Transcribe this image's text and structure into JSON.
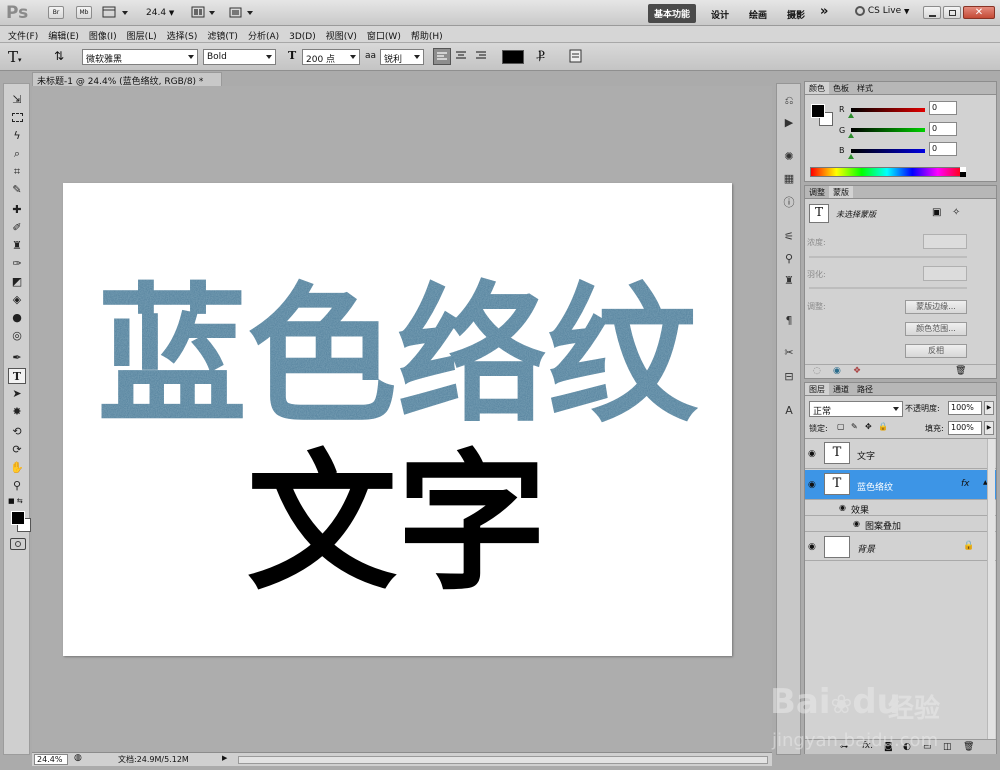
{
  "app": {
    "logo": "Ps",
    "zoom_combo": "24.4",
    "workspaces": [
      "基本功能",
      "设计",
      "绘画",
      "摄影"
    ],
    "more": "»",
    "cs_live": "CS Live"
  },
  "menu": [
    "文件(F)",
    "编辑(E)",
    "图像(I)",
    "图层(L)",
    "选择(S)",
    "滤镜(T)",
    "分析(A)",
    "3D(D)",
    "视图(V)",
    "窗口(W)",
    "帮助(H)"
  ],
  "options": {
    "font_family": "微软雅黑",
    "font_style": "Bold",
    "font_size": "200 点",
    "aa_label": "aa",
    "aa_mode": "锐利",
    "color_swatch": "#000000"
  },
  "document": {
    "tab_title": "未标题-1 @ 24.4% (蓝色络纹, RGB/8) *",
    "close": "×",
    "line1": "蓝色络纹",
    "line2": "文字",
    "line1_color": "#4e7d9a",
    "line2_color": "#000000"
  },
  "status": {
    "zoom": "24.4%",
    "doc_info": "文档:24.9M/5.12M"
  },
  "color_panel": {
    "tabs": [
      "颜色",
      "色板",
      "样式"
    ],
    "channels": [
      {
        "label": "R",
        "value": "0"
      },
      {
        "label": "G",
        "value": "0"
      },
      {
        "label": "B",
        "value": "0"
      }
    ]
  },
  "adjust_panel": {
    "tabs": [
      "调整",
      "蒙版"
    ],
    "header": "未选择蒙版",
    "density_label": "浓度:",
    "feather_label": "羽化:",
    "refine_label": "调整:",
    "buttons": [
      "蒙版边缘...",
      "颜色范围...",
      "反相"
    ]
  },
  "layers_panel": {
    "tabs": [
      "图层",
      "通道",
      "路径"
    ],
    "blend_mode": "正常",
    "opacity_label": "不透明度:",
    "opacity": "100%",
    "lock_label": "锁定:",
    "fill_label": "填充:",
    "fill": "100%",
    "layers": [
      {
        "name": "文字",
        "thumb": "T"
      },
      {
        "name": "蓝色络纹",
        "thumb": "T",
        "fx": "fx"
      },
      {
        "name": "效果"
      },
      {
        "name": "图案叠加"
      },
      {
        "name": "背景"
      }
    ]
  },
  "watermark": {
    "brand": "Bai",
    "brand2": "du",
    "cn": "经验",
    "url": "jingyan.baidu.com"
  }
}
